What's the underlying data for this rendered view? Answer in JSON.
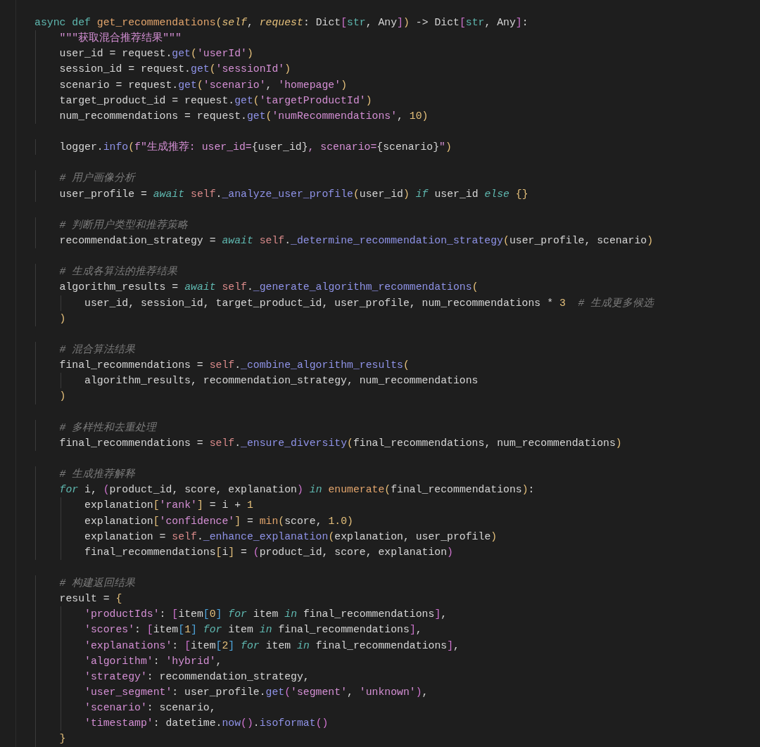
{
  "editor": {
    "lines": [
      {
        "kind": "code",
        "tokens": [
          {
            "kind": "kw",
            "text": "async def "
          },
          {
            "kind": "fn",
            "text": "get_recommendations"
          },
          {
            "kind": "py",
            "text": "("
          },
          {
            "kind": "pa",
            "text": "self"
          },
          {
            "kind": "p",
            "text": ", "
          },
          {
            "kind": "pa",
            "text": "request"
          },
          {
            "kind": "p",
            "text": ": Dict"
          },
          {
            "kind": "pm",
            "text": "["
          },
          {
            "kind": "ty",
            "text": "str"
          },
          {
            "kind": "p",
            "text": ", Any"
          },
          {
            "kind": "pm",
            "text": "]"
          },
          {
            "kind": "py",
            "text": ")"
          },
          {
            "kind": "p",
            "text": " -> Dict"
          },
          {
            "kind": "pm",
            "text": "["
          },
          {
            "kind": "ty",
            "text": "str"
          },
          {
            "kind": "p",
            "text": ", Any"
          },
          {
            "kind": "pm",
            "text": "]"
          },
          {
            "kind": "p",
            "text": ":"
          }
        ]
      },
      {
        "kind": "code",
        "tokens": [
          {
            "kind": "s",
            "text": "    \"\"\"获取混合推荐结果\"\"\""
          }
        ]
      },
      {
        "kind": "code",
        "tokens": [
          {
            "kind": "p",
            "text": "    user_id = request."
          },
          {
            "kind": "m",
            "text": "get"
          },
          {
            "kind": "py",
            "text": "("
          },
          {
            "kind": "s",
            "text": "'userId'"
          },
          {
            "kind": "py",
            "text": ")"
          }
        ]
      },
      {
        "kind": "code",
        "tokens": [
          {
            "kind": "p",
            "text": "    session_id = request."
          },
          {
            "kind": "m",
            "text": "get"
          },
          {
            "kind": "py",
            "text": "("
          },
          {
            "kind": "s",
            "text": "'sessionId'"
          },
          {
            "kind": "py",
            "text": ")"
          }
        ]
      },
      {
        "kind": "code",
        "tokens": [
          {
            "kind": "p",
            "text": "    scenario = request."
          },
          {
            "kind": "m",
            "text": "get"
          },
          {
            "kind": "py",
            "text": "("
          },
          {
            "kind": "s",
            "text": "'scenario'"
          },
          {
            "kind": "p",
            "text": ", "
          },
          {
            "kind": "s",
            "text": "'homepage'"
          },
          {
            "kind": "py",
            "text": ")"
          }
        ]
      },
      {
        "kind": "code",
        "tokens": [
          {
            "kind": "p",
            "text": "    target_product_id = request."
          },
          {
            "kind": "m",
            "text": "get"
          },
          {
            "kind": "py",
            "text": "("
          },
          {
            "kind": "s",
            "text": "'targetProductId'"
          },
          {
            "kind": "py",
            "text": ")"
          }
        ]
      },
      {
        "kind": "code",
        "tokens": [
          {
            "kind": "p",
            "text": "    num_recommendations = request."
          },
          {
            "kind": "m",
            "text": "get"
          },
          {
            "kind": "py",
            "text": "("
          },
          {
            "kind": "s",
            "text": "'numRecommendations'"
          },
          {
            "kind": "p",
            "text": ", "
          },
          {
            "kind": "n",
            "text": "10"
          },
          {
            "kind": "py",
            "text": ")"
          }
        ]
      },
      {
        "kind": "blank"
      },
      {
        "kind": "code",
        "tokens": [
          {
            "kind": "p",
            "text": "    logger."
          },
          {
            "kind": "m",
            "text": "info"
          },
          {
            "kind": "py",
            "text": "("
          },
          {
            "kind": "s",
            "text": "f\"生成推荐: user_id="
          },
          {
            "kind": "p",
            "text": "{user_id}"
          },
          {
            "kind": "s",
            "text": ", scenario="
          },
          {
            "kind": "p",
            "text": "{scenario}"
          },
          {
            "kind": "s",
            "text": "\""
          },
          {
            "kind": "py",
            "text": ")"
          }
        ]
      },
      {
        "kind": "blank"
      },
      {
        "kind": "code",
        "tokens": [
          {
            "kind": "c",
            "text": "    # 用户画像分析"
          }
        ]
      },
      {
        "kind": "code",
        "tokens": [
          {
            "kind": "p",
            "text": "    user_profile = "
          },
          {
            "kind": "ki",
            "text": "await"
          },
          {
            "kind": "sf",
            "text": " self"
          },
          {
            "kind": "p",
            "text": "."
          },
          {
            "kind": "m",
            "text": "_analyze_user_profile"
          },
          {
            "kind": "py",
            "text": "("
          },
          {
            "kind": "p",
            "text": "user_id"
          },
          {
            "kind": "py",
            "text": ")"
          },
          {
            "kind": "ki",
            "text": " if"
          },
          {
            "kind": "p",
            "text": " user_id "
          },
          {
            "kind": "ki",
            "text": "else"
          },
          {
            "kind": "py",
            "text": " {}"
          }
        ]
      },
      {
        "kind": "blank"
      },
      {
        "kind": "code",
        "tokens": [
          {
            "kind": "c",
            "text": "    # 判断用户类型和推荐策略"
          }
        ]
      },
      {
        "kind": "code",
        "tokens": [
          {
            "kind": "p",
            "text": "    recommendation_strategy = "
          },
          {
            "kind": "ki",
            "text": "await"
          },
          {
            "kind": "sf",
            "text": " self"
          },
          {
            "kind": "p",
            "text": "."
          },
          {
            "kind": "m",
            "text": "_determine_recommendation_strategy"
          },
          {
            "kind": "py",
            "text": "("
          },
          {
            "kind": "p",
            "text": "user_profile, scenario"
          },
          {
            "kind": "py",
            "text": ")"
          }
        ]
      },
      {
        "kind": "blank"
      },
      {
        "kind": "code",
        "tokens": [
          {
            "kind": "c",
            "text": "    # 生成各算法的推荐结果"
          }
        ]
      },
      {
        "kind": "code",
        "tokens": [
          {
            "kind": "p",
            "text": "    algorithm_results = "
          },
          {
            "kind": "ki",
            "text": "await"
          },
          {
            "kind": "sf",
            "text": " self"
          },
          {
            "kind": "p",
            "text": "."
          },
          {
            "kind": "m",
            "text": "_generate_algorithm_recommendations"
          },
          {
            "kind": "py",
            "text": "("
          }
        ]
      },
      {
        "kind": "code",
        "tokens": [
          {
            "kind": "p",
            "text": "        user_id, session_id, target_product_id, user_profile, num_recommendations * "
          },
          {
            "kind": "n",
            "text": "3"
          },
          {
            "kind": "c",
            "text": "  # 生成更多候选"
          }
        ]
      },
      {
        "kind": "code",
        "tokens": [
          {
            "kind": "py",
            "text": "    )"
          }
        ]
      },
      {
        "kind": "blank"
      },
      {
        "kind": "code",
        "tokens": [
          {
            "kind": "c",
            "text": "    # 混合算法结果"
          }
        ]
      },
      {
        "kind": "code",
        "tokens": [
          {
            "kind": "p",
            "text": "    final_recommendations = "
          },
          {
            "kind": "sf",
            "text": "self"
          },
          {
            "kind": "p",
            "text": "."
          },
          {
            "kind": "m",
            "text": "_combine_algorithm_results"
          },
          {
            "kind": "py",
            "text": "("
          }
        ]
      },
      {
        "kind": "code",
        "tokens": [
          {
            "kind": "p",
            "text": "        algorithm_results, recommendation_strategy, num_recommendations"
          }
        ]
      },
      {
        "kind": "code",
        "tokens": [
          {
            "kind": "py",
            "text": "    )"
          }
        ]
      },
      {
        "kind": "blank"
      },
      {
        "kind": "code",
        "tokens": [
          {
            "kind": "c",
            "text": "    # 多样性和去重处理"
          }
        ]
      },
      {
        "kind": "code",
        "tokens": [
          {
            "kind": "p",
            "text": "    final_recommendations = "
          },
          {
            "kind": "sf",
            "text": "self"
          },
          {
            "kind": "p",
            "text": "."
          },
          {
            "kind": "m",
            "text": "_ensure_diversity"
          },
          {
            "kind": "py",
            "text": "("
          },
          {
            "kind": "p",
            "text": "final_recommendations, num_recommendations"
          },
          {
            "kind": "py",
            "text": ")"
          }
        ]
      },
      {
        "kind": "blank"
      },
      {
        "kind": "code",
        "tokens": [
          {
            "kind": "c",
            "text": "    # 生成推荐解释"
          }
        ]
      },
      {
        "kind": "code",
        "tokens": [
          {
            "kind": "ki",
            "text": "    for"
          },
          {
            "kind": "p",
            "text": " i, "
          },
          {
            "kind": "pm",
            "text": "("
          },
          {
            "kind": "p",
            "text": "product_id, score, explanation"
          },
          {
            "kind": "pm",
            "text": ")"
          },
          {
            "kind": "ki",
            "text": " in"
          },
          {
            "kind": "fn",
            "text": " enumerate"
          },
          {
            "kind": "py",
            "text": "("
          },
          {
            "kind": "p",
            "text": "final_recommendations"
          },
          {
            "kind": "py",
            "text": ")"
          },
          {
            "kind": "p",
            "text": ":"
          }
        ]
      },
      {
        "kind": "code",
        "tokens": [
          {
            "kind": "p",
            "text": "        explanation"
          },
          {
            "kind": "py",
            "text": "["
          },
          {
            "kind": "s",
            "text": "'rank'"
          },
          {
            "kind": "py",
            "text": "]"
          },
          {
            "kind": "p",
            "text": " = i + "
          },
          {
            "kind": "n",
            "text": "1"
          }
        ]
      },
      {
        "kind": "code",
        "tokens": [
          {
            "kind": "p",
            "text": "        explanation"
          },
          {
            "kind": "py",
            "text": "["
          },
          {
            "kind": "s",
            "text": "'confidence'"
          },
          {
            "kind": "py",
            "text": "]"
          },
          {
            "kind": "p",
            "text": " = "
          },
          {
            "kind": "fn",
            "text": "min"
          },
          {
            "kind": "py",
            "text": "("
          },
          {
            "kind": "p",
            "text": "score, "
          },
          {
            "kind": "n",
            "text": "1.0"
          },
          {
            "kind": "py",
            "text": ")"
          }
        ]
      },
      {
        "kind": "code",
        "tokens": [
          {
            "kind": "p",
            "text": "        explanation = "
          },
          {
            "kind": "sf",
            "text": "self"
          },
          {
            "kind": "p",
            "text": "."
          },
          {
            "kind": "m",
            "text": "_enhance_explanation"
          },
          {
            "kind": "py",
            "text": "("
          },
          {
            "kind": "p",
            "text": "explanation, user_profile"
          },
          {
            "kind": "py",
            "text": ")"
          }
        ]
      },
      {
        "kind": "code",
        "tokens": [
          {
            "kind": "p",
            "text": "        final_recommendations"
          },
          {
            "kind": "py",
            "text": "["
          },
          {
            "kind": "p",
            "text": "i"
          },
          {
            "kind": "py",
            "text": "]"
          },
          {
            "kind": "p",
            "text": " = "
          },
          {
            "kind": "pm",
            "text": "("
          },
          {
            "kind": "p",
            "text": "product_id, score, explanation"
          },
          {
            "kind": "pm",
            "text": ")"
          }
        ]
      },
      {
        "kind": "blank"
      },
      {
        "kind": "code",
        "tokens": [
          {
            "kind": "c",
            "text": "    # 构建返回结果"
          }
        ]
      },
      {
        "kind": "code",
        "tokens": [
          {
            "kind": "p",
            "text": "    result = "
          },
          {
            "kind": "py",
            "text": "{"
          }
        ]
      },
      {
        "kind": "code",
        "tokens": [
          {
            "kind": "s",
            "text": "        'productIds'"
          },
          {
            "kind": "p",
            "text": ": "
          },
          {
            "kind": "pm",
            "text": "["
          },
          {
            "kind": "p",
            "text": "item"
          },
          {
            "kind": "pb",
            "text": "["
          },
          {
            "kind": "n",
            "text": "0"
          },
          {
            "kind": "pb",
            "text": "]"
          },
          {
            "kind": "ki",
            "text": " for"
          },
          {
            "kind": "p",
            "text": " item "
          },
          {
            "kind": "ki",
            "text": "in"
          },
          {
            "kind": "p",
            "text": " final_recommendations"
          },
          {
            "kind": "pm",
            "text": "]"
          },
          {
            "kind": "p",
            "text": ","
          }
        ]
      },
      {
        "kind": "code",
        "tokens": [
          {
            "kind": "s",
            "text": "        'scores'"
          },
          {
            "kind": "p",
            "text": ": "
          },
          {
            "kind": "pm",
            "text": "["
          },
          {
            "kind": "p",
            "text": "item"
          },
          {
            "kind": "pb",
            "text": "["
          },
          {
            "kind": "n",
            "text": "1"
          },
          {
            "kind": "pb",
            "text": "]"
          },
          {
            "kind": "ki",
            "text": " for"
          },
          {
            "kind": "p",
            "text": " item "
          },
          {
            "kind": "ki",
            "text": "in"
          },
          {
            "kind": "p",
            "text": " final_recommendations"
          },
          {
            "kind": "pm",
            "text": "]"
          },
          {
            "kind": "p",
            "text": ","
          }
        ]
      },
      {
        "kind": "code",
        "tokens": [
          {
            "kind": "s",
            "text": "        'explanations'"
          },
          {
            "kind": "p",
            "text": ": "
          },
          {
            "kind": "pm",
            "text": "["
          },
          {
            "kind": "p",
            "text": "item"
          },
          {
            "kind": "pb",
            "text": "["
          },
          {
            "kind": "n",
            "text": "2"
          },
          {
            "kind": "pb",
            "text": "]"
          },
          {
            "kind": "ki",
            "text": " for"
          },
          {
            "kind": "p",
            "text": " item "
          },
          {
            "kind": "ki",
            "text": "in"
          },
          {
            "kind": "p",
            "text": " final_recommendations"
          },
          {
            "kind": "pm",
            "text": "]"
          },
          {
            "kind": "p",
            "text": ","
          }
        ]
      },
      {
        "kind": "code",
        "tokens": [
          {
            "kind": "s",
            "text": "        'algorithm'"
          },
          {
            "kind": "p",
            "text": ": "
          },
          {
            "kind": "s",
            "text": "'hybrid'"
          },
          {
            "kind": "p",
            "text": ","
          }
        ]
      },
      {
        "kind": "code",
        "tokens": [
          {
            "kind": "s",
            "text": "        'strategy'"
          },
          {
            "kind": "p",
            "text": ": recommendation_strategy,"
          }
        ]
      },
      {
        "kind": "code",
        "tokens": [
          {
            "kind": "s",
            "text": "        'user_segment'"
          },
          {
            "kind": "p",
            "text": ": user_profile."
          },
          {
            "kind": "m",
            "text": "get"
          },
          {
            "kind": "pm",
            "text": "("
          },
          {
            "kind": "s",
            "text": "'segment'"
          },
          {
            "kind": "p",
            "text": ", "
          },
          {
            "kind": "s",
            "text": "'unknown'"
          },
          {
            "kind": "pm",
            "text": ")"
          },
          {
            "kind": "p",
            "text": ","
          }
        ]
      },
      {
        "kind": "code",
        "tokens": [
          {
            "kind": "s",
            "text": "        'scenario'"
          },
          {
            "kind": "p",
            "text": ": scenario,"
          }
        ]
      },
      {
        "kind": "code",
        "tokens": [
          {
            "kind": "s",
            "text": "        'timestamp'"
          },
          {
            "kind": "p",
            "text": ": datetime."
          },
          {
            "kind": "m",
            "text": "now"
          },
          {
            "kind": "pm",
            "text": "()"
          },
          {
            "kind": "p",
            "text": "."
          },
          {
            "kind": "m",
            "text": "isoformat"
          },
          {
            "kind": "pm",
            "text": "()"
          }
        ]
      },
      {
        "kind": "code",
        "tokens": [
          {
            "kind": "py",
            "text": "    }"
          }
        ]
      }
    ]
  }
}
